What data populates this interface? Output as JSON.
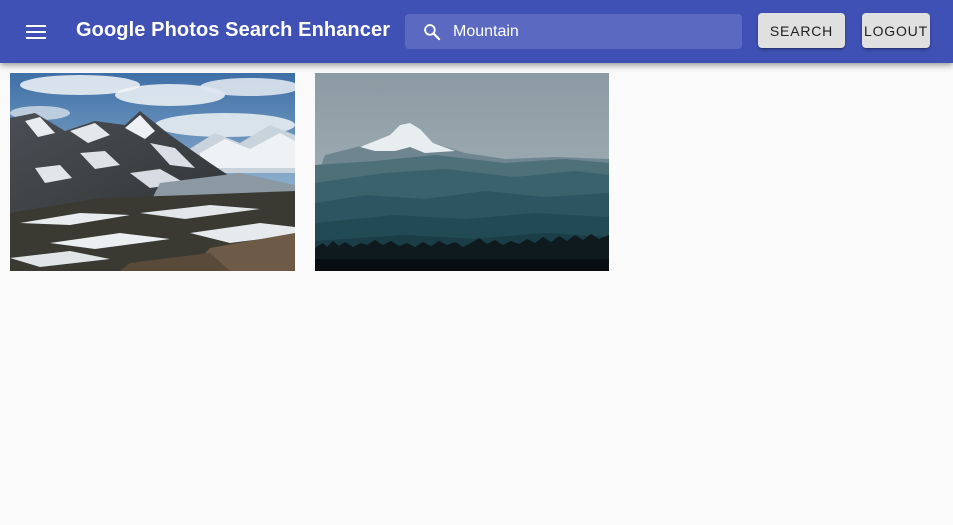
{
  "app": {
    "title": "Google Photos Search Enhancer",
    "menu_icon": "menu-icon",
    "theme_color": "#3f51b5"
  },
  "search": {
    "icon": "search-icon",
    "value": "Mountain"
  },
  "actions": {
    "search_label": "SEARCH",
    "logout_label": "LOGOUT"
  },
  "results": [
    {
      "subject": "snowy-mountain-ridge-photo"
    },
    {
      "subject": "snow-capped-peak-over-forested-hills-photo"
    }
  ]
}
